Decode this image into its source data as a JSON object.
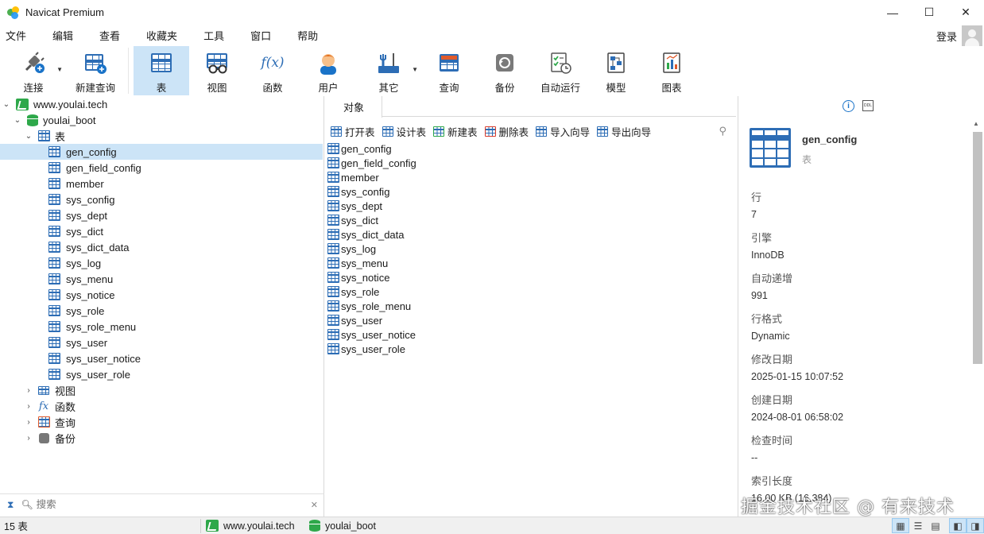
{
  "window": {
    "title": "Navicat Premium",
    "minimize": "—",
    "maximize": "☐",
    "close": "✕"
  },
  "menu": {
    "items": [
      "文件",
      "编辑",
      "查看",
      "收藏夹",
      "工具",
      "窗口",
      "帮助"
    ],
    "login": "登录"
  },
  "toolbar": {
    "connect": "连接",
    "new_query": "新建查询",
    "table": "表",
    "view": "视图",
    "function": "函数",
    "user": "用户",
    "other": "其它",
    "query": "查询",
    "backup": "备份",
    "automation": "自动运行",
    "model": "模型",
    "chart": "图表",
    "fx": "f(x)"
  },
  "nav": {
    "connection": "www.youlai.tech",
    "database": "youlai_boot",
    "tables_group": "表",
    "tables": [
      "gen_config",
      "gen_field_config",
      "member",
      "sys_config",
      "sys_dept",
      "sys_dict",
      "sys_dict_data",
      "sys_log",
      "sys_menu",
      "sys_notice",
      "sys_role",
      "sys_role_menu",
      "sys_user",
      "sys_user_notice",
      "sys_user_role"
    ],
    "selected_table": "gen_config",
    "groups": [
      "视图",
      "函数",
      "查询",
      "备份"
    ],
    "search_placeholder": "搜索"
  },
  "objects": {
    "tab": "对象",
    "actions": [
      "打开表",
      "设计表",
      "新建表",
      "删除表",
      "导入向导",
      "导出向导"
    ],
    "list": [
      "gen_config",
      "gen_field_config",
      "member",
      "sys_config",
      "sys_dept",
      "sys_dict",
      "sys_dict_data",
      "sys_log",
      "sys_menu",
      "sys_notice",
      "sys_role",
      "sys_role_menu",
      "sys_user",
      "sys_user_notice",
      "sys_user_role"
    ]
  },
  "info": {
    "name": "gen_config",
    "type": "表",
    "ddl_label": "DDL",
    "info_label": "i",
    "props": [
      {
        "key": "行",
        "value": "7"
      },
      {
        "key": "引擎",
        "value": "InnoDB"
      },
      {
        "key": "自动递增",
        "value": "991"
      },
      {
        "key": "行格式",
        "value": "Dynamic"
      },
      {
        "key": "修改日期",
        "value": "2025-01-15 10:07:52"
      },
      {
        "key": "创建日期",
        "value": "2024-08-01 06:58:02"
      },
      {
        "key": "检查时间",
        "value": "--"
      },
      {
        "key": "索引长度",
        "value": "16.00 KB (16,384)"
      }
    ]
  },
  "status": {
    "count": "15 表",
    "connection": "www.youlai.tech",
    "database": "youlai_boot"
  },
  "watermark": "掘金技术社区 @ 有来技术"
}
